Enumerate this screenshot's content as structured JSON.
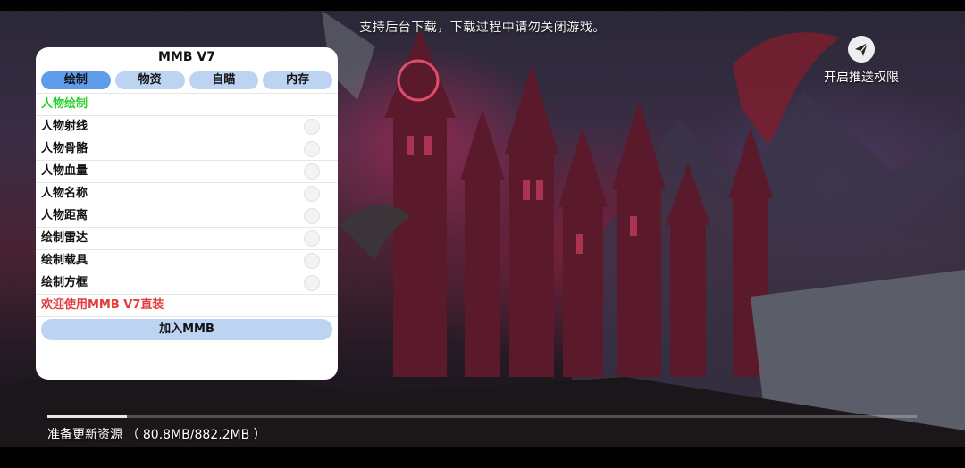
{
  "top_notice": "支持后台下载，下载过程中请勿关闭游戏。",
  "push_button": {
    "label": "开启推送权限",
    "icon": "paper-plane-icon"
  },
  "panel": {
    "title": "MMB V7",
    "tabs": [
      {
        "label": "绘制",
        "active": true
      },
      {
        "label": "物资",
        "active": false
      },
      {
        "label": "自瞄",
        "active": false
      },
      {
        "label": "内存",
        "active": false
      }
    ],
    "section_title": "人物绘制",
    "options": [
      {
        "label": "人物射线",
        "enabled": false
      },
      {
        "label": "人物骨骼",
        "enabled": false
      },
      {
        "label": "人物血量",
        "enabled": false
      },
      {
        "label": "人物名称",
        "enabled": false
      },
      {
        "label": "人物距离",
        "enabled": false
      },
      {
        "label": "绘制雷达",
        "enabled": false
      },
      {
        "label": "绘制载具",
        "enabled": false
      },
      {
        "label": "绘制方框",
        "enabled": false
      }
    ],
    "welcome_text": "欢迎使用MMB V7直装",
    "join_button": "加入MMB"
  },
  "download": {
    "status_text": "准备更新资源 （ 80.8MB/882.2MB ）",
    "downloaded_mb": 80.8,
    "total_mb": 882.2
  },
  "colors": {
    "tab_active": "#5e9bea",
    "tab_inactive": "#bcd3f2",
    "section_green": "#27d12a",
    "welcome_red": "#e23b3b"
  }
}
